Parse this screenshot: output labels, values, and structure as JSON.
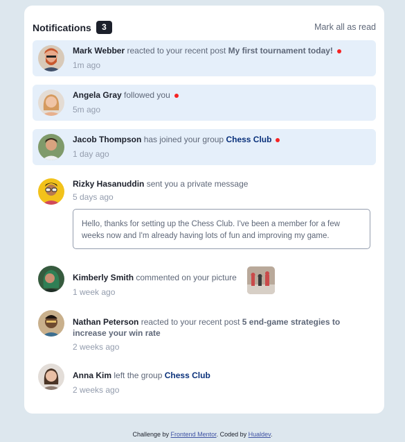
{
  "header": {
    "title": "Notifications",
    "count": "3",
    "mark_all": "Mark all as read"
  },
  "notifications": [
    {
      "name": "Mark Webber",
      "action": "reacted to your recent post",
      "target": "My first tournament today!",
      "time": "1m ago",
      "unread": true
    },
    {
      "name": "Angela Gray",
      "action": "followed you",
      "time": "5m ago",
      "unread": true
    },
    {
      "name": "Jacob Thompson",
      "action": "has joined your group",
      "target": "Chess Club",
      "time": "1 day ago",
      "unread": true
    },
    {
      "name": "Rizky Hasanuddin",
      "action": "sent you a private message",
      "time": "5 days ago",
      "message": "Hello, thanks for setting up the Chess Club. I've been a member for a few weeks now and I'm already having lots of fun and improving my game.",
      "unread": false
    },
    {
      "name": "Kimberly Smith",
      "action": "commented on your picture",
      "time": "1 week ago",
      "unread": false
    },
    {
      "name": "Nathan Peterson",
      "action": "reacted to your recent post",
      "target": "5 end-game strategies to increase your win rate",
      "time": "2 weeks ago",
      "unread": false
    },
    {
      "name": "Anna Kim",
      "action": "left the group",
      "target": "Chess Club",
      "time": "2 weeks ago",
      "unread": false
    }
  ],
  "footer": {
    "prefix": "Challenge by",
    "link1": "Frontend Mentor",
    "middle": ". Coded by",
    "link2": "Hualdev",
    "suffix": "."
  },
  "colors": {
    "unread_bg": "#e5effa",
    "dot": "#f62323",
    "group_link": "#0a317b",
    "page_bg": "#dde7ee"
  }
}
